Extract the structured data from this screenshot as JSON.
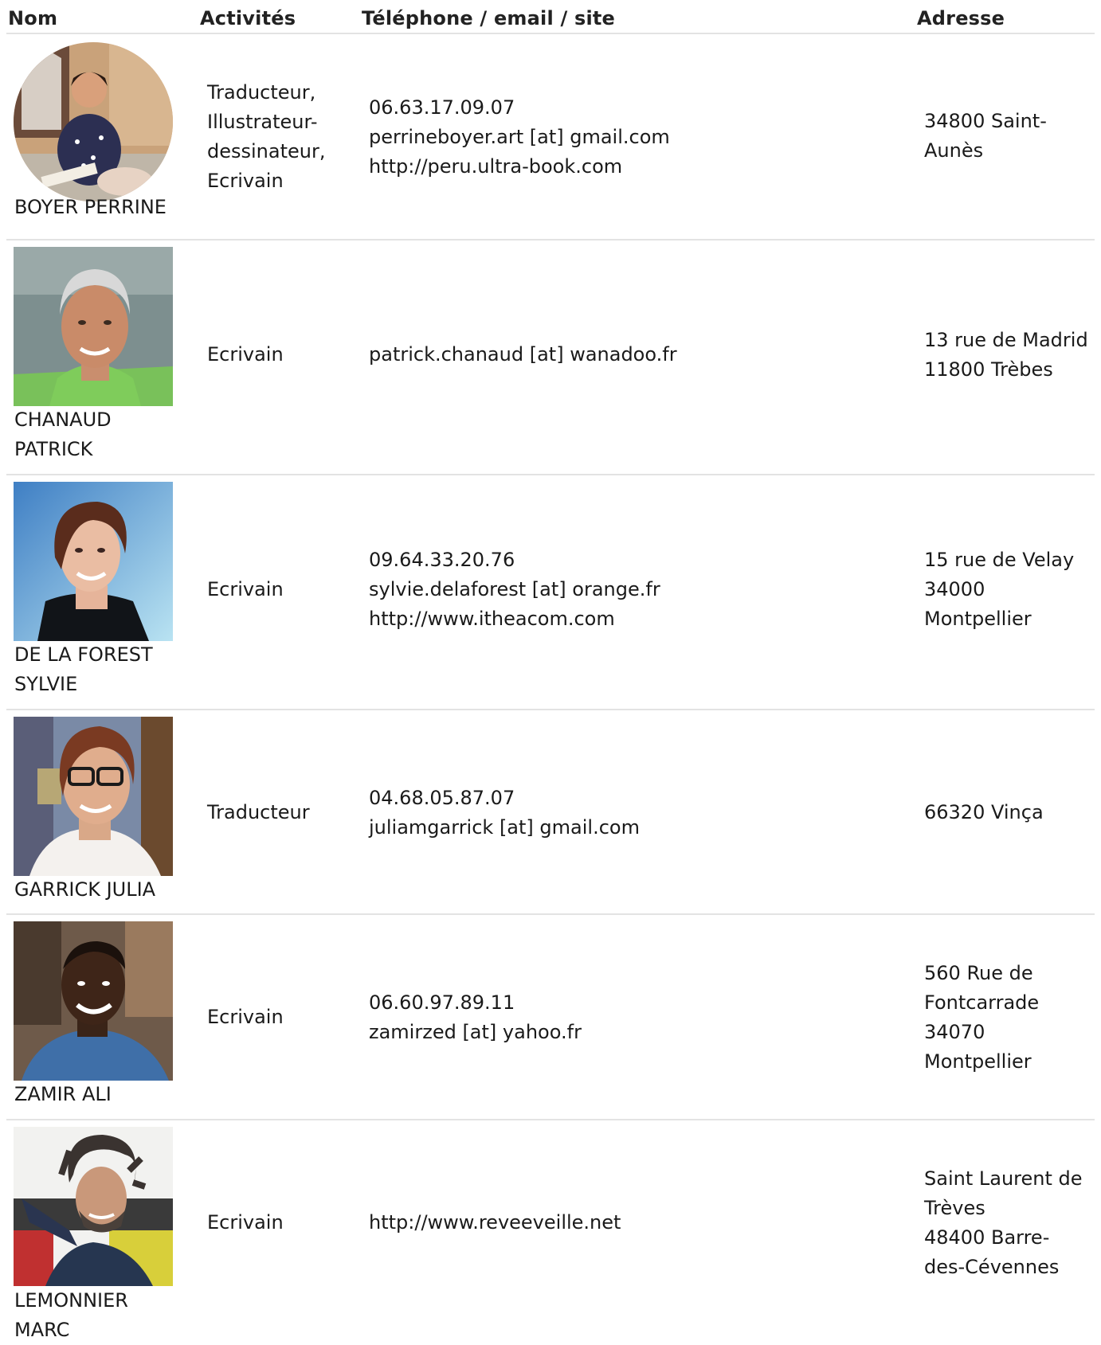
{
  "header": {
    "col_name": "Nom",
    "col_activities": "Activités",
    "col_contact": "Téléphone / email / site",
    "col_address": "Adresse"
  },
  "rows": [
    {
      "name": "BOYER PERRINE",
      "activities": [
        "Traducteur,",
        "Illustrateur-",
        "dessinateur,",
        "Ecrivain"
      ],
      "contact": [
        "06.63.17.09.07",
        "perrineboyer.art [at] gmail.com",
        "http://peru.ultra-book.com"
      ],
      "address": [
        "34800 Saint-",
        "Aunès"
      ],
      "photo_icon": "portrait-photo"
    },
    {
      "name_lines": [
        "CHANAUD",
        "PATRICK"
      ],
      "activities": [
        "Ecrivain"
      ],
      "contact": [
        "patrick.chanaud [at] wanadoo.fr"
      ],
      "address": [
        "13 rue de Madrid",
        "11800 Trèbes"
      ],
      "photo_icon": "portrait-photo"
    },
    {
      "name_lines": [
        "DE LA FOREST",
        "SYLVIE"
      ],
      "activities": [
        "Ecrivain"
      ],
      "contact": [
        "09.64.33.20.76",
        "sylvie.delaforest [at] orange.fr",
        "http://www.itheacom.com"
      ],
      "address": [
        "15 rue de Velay",
        "34000",
        "Montpellier"
      ],
      "photo_icon": "portrait-photo"
    },
    {
      "name": "GARRICK JULIA",
      "activities": [
        "Traducteur"
      ],
      "contact": [
        "04.68.05.87.07",
        "juliamgarrick [at] gmail.com"
      ],
      "address": [
        "66320 Vinça"
      ],
      "photo_icon": "portrait-photo"
    },
    {
      "name": "ZAMIR ALI",
      "activities": [
        "Ecrivain"
      ],
      "contact": [
        "06.60.97.89.11",
        "zamirzed [at] yahoo.fr"
      ],
      "address": [
        "560 Rue de",
        "Fontcarrade",
        "34070",
        "Montpellier"
      ],
      "photo_icon": "portrait-photo"
    },
    {
      "name": "LEMONNIER MARC",
      "activities": [
        "Ecrivain"
      ],
      "contact": [
        "http://www.reveeveille.net"
      ],
      "address": [
        "Saint Laurent de",
        "Trèves",
        "48400 Barre-",
        "des-Cévennes"
      ],
      "photo_icon": "portrait-photo"
    }
  ]
}
